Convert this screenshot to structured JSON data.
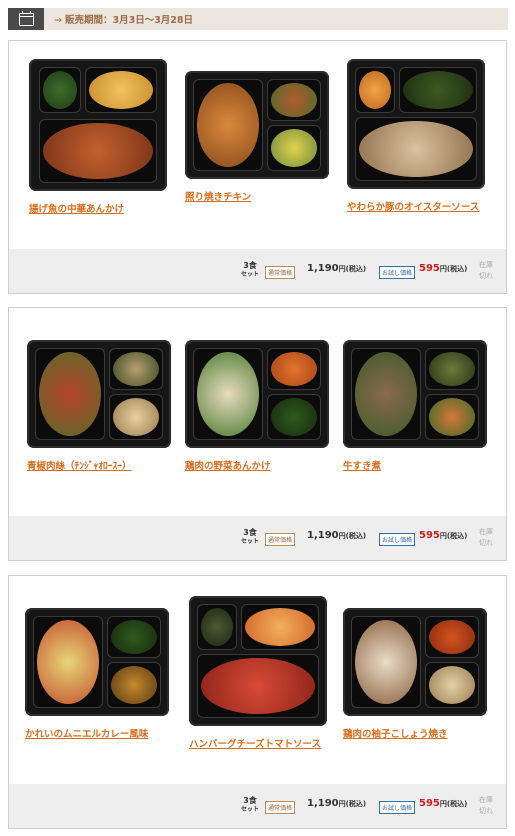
{
  "sales_period": "販売期間：3月3日～3月28日",
  "price_row": {
    "set_count": "3",
    "set_unit": "食",
    "set_label": "セット",
    "regular_badge": "通常価格",
    "regular_price": "1,190",
    "price_unit": "円(税込)",
    "sale_badge": "お試し価格",
    "sale_price": "595",
    "stock_status": "在庫切れ"
  },
  "cards": [
    {
      "items": [
        {
          "name": "揚げ魚の中華あんかけ"
        },
        {
          "name": "照り焼きチキン"
        },
        {
          "name": "やわらか豚のオイスターソース"
        }
      ]
    },
    {
      "items": [
        {
          "name": "青椒肉絲（ﾁﾝｼﾞｬｵﾛｰｽｰ）"
        },
        {
          "name": "鶏肉の野菜あんかけ"
        },
        {
          "name": "牛すき煮"
        }
      ]
    },
    {
      "items": [
        {
          "name": "かれいのムニエルカレー風味"
        },
        {
          "name": "ハンバーグチーズトマトソース"
        },
        {
          "name": "鶏肉の柚子こしょう焼き"
        }
      ]
    }
  ]
}
